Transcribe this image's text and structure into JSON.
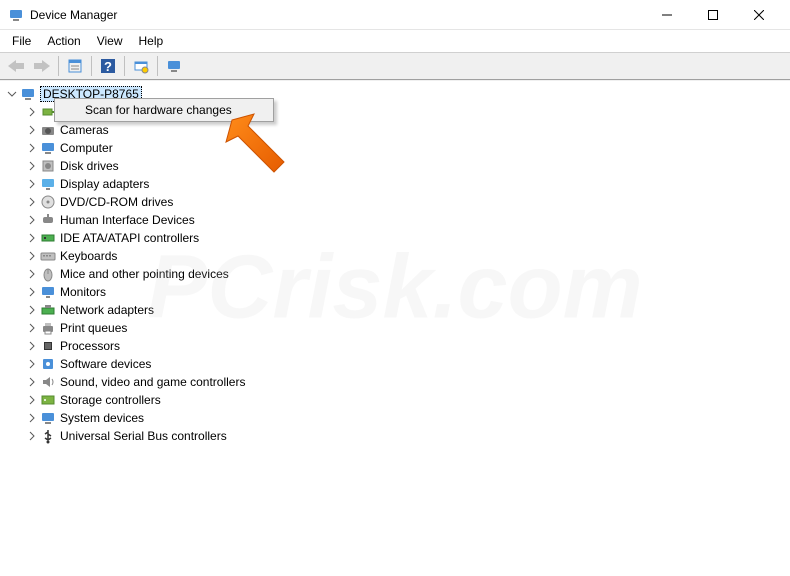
{
  "window": {
    "title": "Device Manager"
  },
  "menu": {
    "file": "File",
    "action": "Action",
    "view": "View",
    "help": "Help"
  },
  "context_menu": {
    "scan": "Scan for hardware changes"
  },
  "tree": {
    "root": "DESKTOP-P8765",
    "items": [
      {
        "label": "Batteries",
        "icon": "battery"
      },
      {
        "label": "Cameras",
        "icon": "camera"
      },
      {
        "label": "Computer",
        "icon": "computer"
      },
      {
        "label": "Disk drives",
        "icon": "disk"
      },
      {
        "label": "Display adapters",
        "icon": "display"
      },
      {
        "label": "DVD/CD-ROM drives",
        "icon": "dvd"
      },
      {
        "label": "Human Interface Devices",
        "icon": "hid"
      },
      {
        "label": "IDE ATA/ATAPI controllers",
        "icon": "ide"
      },
      {
        "label": "Keyboards",
        "icon": "keyboard"
      },
      {
        "label": "Mice and other pointing devices",
        "icon": "mouse"
      },
      {
        "label": "Monitors",
        "icon": "monitor"
      },
      {
        "label": "Network adapters",
        "icon": "network"
      },
      {
        "label": "Print queues",
        "icon": "printer"
      },
      {
        "label": "Processors",
        "icon": "cpu"
      },
      {
        "label": "Software devices",
        "icon": "software"
      },
      {
        "label": "Sound, video and game controllers",
        "icon": "sound"
      },
      {
        "label": "Storage controllers",
        "icon": "storage"
      },
      {
        "label": "System devices",
        "icon": "system"
      },
      {
        "label": "Universal Serial Bus controllers",
        "icon": "usb"
      }
    ]
  },
  "watermark": "PCrisk.com"
}
